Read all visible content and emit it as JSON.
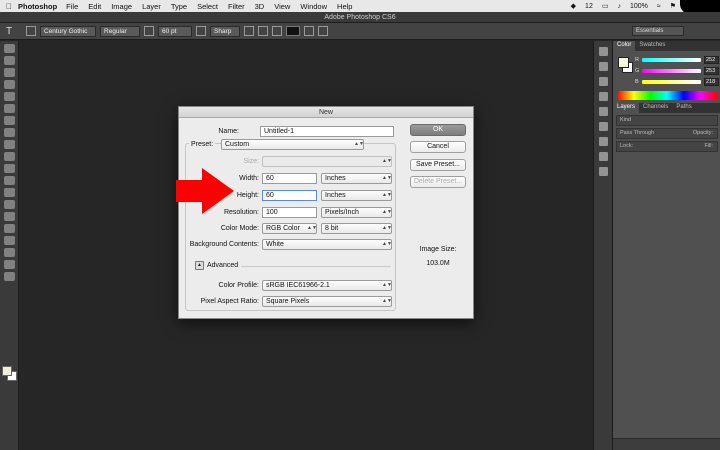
{
  "menubar": {
    "apple": "",
    "app": "Photoshop",
    "items": [
      "File",
      "Edit",
      "Image",
      "Layer",
      "Type",
      "Select",
      "Filter",
      "3D",
      "View",
      "Window",
      "Help"
    ],
    "status": [
      "12",
      "100%"
    ]
  },
  "window": {
    "title": "Adobe Photoshop CS6"
  },
  "options": {
    "tool_icon": "T",
    "font_family": "Century Gothic",
    "font_style": "Regular",
    "font_size": "60 pt",
    "antialias": "Sharp",
    "workspace": "Essentials"
  },
  "panels": {
    "color_tabs": [
      "Color",
      "Swatches"
    ],
    "rgb": [
      {
        "label": "R",
        "value": "252"
      },
      {
        "label": "G",
        "value": "253"
      },
      {
        "label": "B",
        "value": "218"
      }
    ],
    "layers_tabs": [
      "Layers",
      "Channels",
      "Paths"
    ],
    "kind": "Kind",
    "blend": "Pass Through",
    "opacity": "Opacity:",
    "lock": "Lock:",
    "fill": "Fill:"
  },
  "dialog": {
    "title": "New",
    "name_label": "Name:",
    "name_value": "Untitled-1",
    "preset_label": "Preset:",
    "preset_value": "Custom",
    "size_label": "Size:",
    "size_value": "",
    "width_label": "Width:",
    "width_value": "60",
    "width_unit": "Inches",
    "height_label": "Height:",
    "height_value": "60",
    "height_unit": "Inches",
    "resolution_label": "Resolution:",
    "resolution_value": "100",
    "resolution_unit": "Pixels/Inch",
    "color_mode_label": "Color Mode:",
    "color_mode_value": "RGB Color",
    "bit_depth": "8 bit",
    "bg_label": "Background Contents:",
    "bg_value": "White",
    "advanced_label": "Advanced",
    "color_profile_label": "Color Profile:",
    "color_profile_value": "sRGB IEC61966-2.1",
    "pixel_aspect_label": "Pixel Aspect Ratio:",
    "pixel_aspect_value": "Square Pixels",
    "ok": "OK",
    "cancel": "Cancel",
    "save_preset": "Save Preset...",
    "delete_preset": "Delete Preset...",
    "image_size_label": "Image Size:",
    "image_size_value": "103.0M"
  },
  "colors": {
    "accent_arrow": "#ff0000",
    "workspace_bg": "#262626",
    "dialog_bg": "#ececec"
  }
}
